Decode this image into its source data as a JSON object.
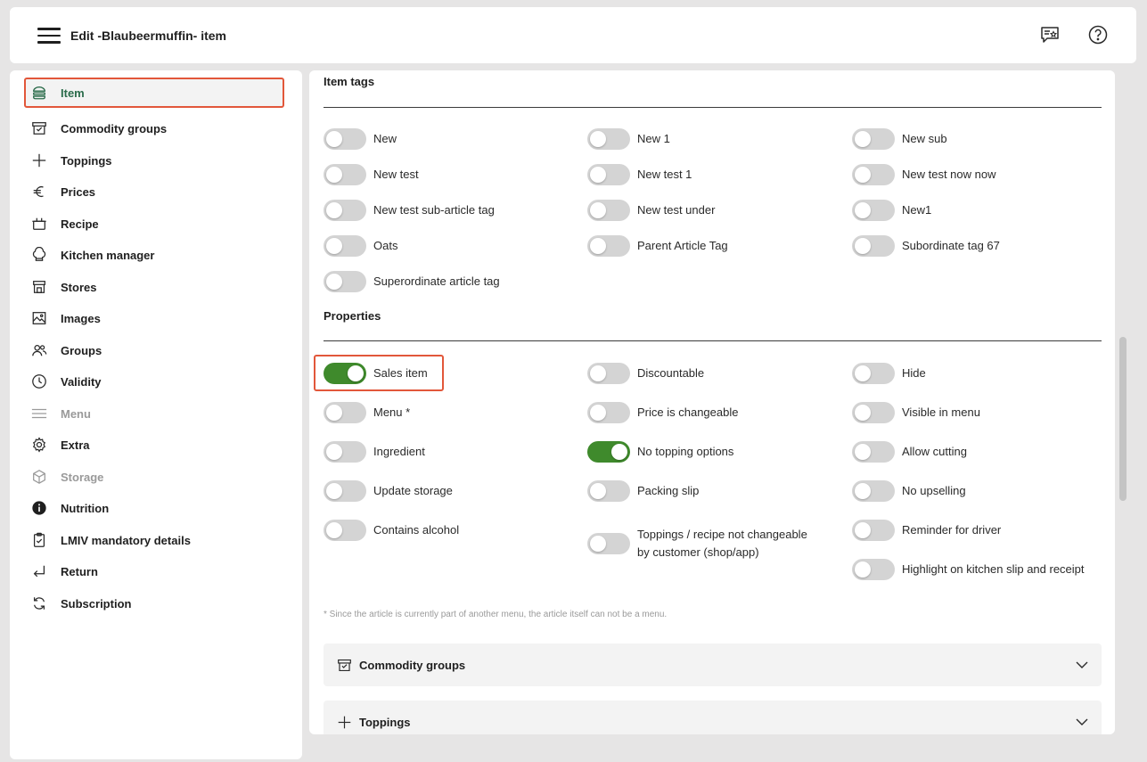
{
  "header": {
    "title": "Edit -Blaubeermuffin- item"
  },
  "sidebar": {
    "items": [
      {
        "label": "Item",
        "icon": "burger-icon"
      },
      {
        "label": "Commodity groups",
        "icon": "tag-box-icon"
      },
      {
        "label": "Toppings",
        "icon": "plus-icon"
      },
      {
        "label": "Prices",
        "icon": "euro-icon"
      },
      {
        "label": "Recipe",
        "icon": "pot-icon"
      },
      {
        "label": "Kitchen manager",
        "icon": "chef-hat-icon"
      },
      {
        "label": "Stores",
        "icon": "store-icon"
      },
      {
        "label": "Images",
        "icon": "image-icon"
      },
      {
        "label": "Groups",
        "icon": "users-icon"
      },
      {
        "label": "Validity",
        "icon": "clock-icon"
      },
      {
        "label": "Menu",
        "icon": "menu-lines-icon"
      },
      {
        "label": "Extra",
        "icon": "gear-icon"
      },
      {
        "label": "Storage",
        "icon": "cube-icon"
      },
      {
        "label": "Nutrition",
        "icon": "info-icon"
      },
      {
        "label": "LMIV mandatory details",
        "icon": "clipboard-check-icon"
      },
      {
        "label": "Return",
        "icon": "return-icon"
      },
      {
        "label": "Subscription",
        "icon": "refresh-icon"
      }
    ]
  },
  "item_tags": {
    "title": "Item tags",
    "toggles": [
      {
        "label": "New",
        "on": false
      },
      {
        "label": "New 1",
        "on": false
      },
      {
        "label": "New sub",
        "on": false
      },
      {
        "label": "New test",
        "on": false
      },
      {
        "label": "New test 1",
        "on": false
      },
      {
        "label": "New test now now",
        "on": false
      },
      {
        "label": "New test sub-article tag",
        "on": false
      },
      {
        "label": "New test under",
        "on": false
      },
      {
        "label": "New1",
        "on": false
      },
      {
        "label": "Oats",
        "on": false
      },
      {
        "label": "Parent Article Tag",
        "on": false
      },
      {
        "label": "Subordinate tag 67",
        "on": false
      },
      {
        "label": "Superordinate article tag",
        "on": false
      }
    ]
  },
  "properties": {
    "title": "Properties",
    "toggles": [
      {
        "label": "Sales item",
        "on": true
      },
      {
        "label": "Discountable",
        "on": false
      },
      {
        "label": "Hide",
        "on": false
      },
      {
        "label": "Menu *",
        "on": false
      },
      {
        "label": "Price is changeable",
        "on": false
      },
      {
        "label": "Visible in menu",
        "on": false
      },
      {
        "label": "Ingredient",
        "on": false
      },
      {
        "label": "No topping options",
        "on": true
      },
      {
        "label": "Allow cutting",
        "on": false
      },
      {
        "label": "Update storage",
        "on": false
      },
      {
        "label": "Packing slip",
        "on": false
      },
      {
        "label": "No upselling",
        "on": false
      },
      {
        "label": "Contains alcohol",
        "on": false
      },
      {
        "label": "Toppings / recipe not changeable",
        "label2": "by customer (shop/app)",
        "on": false
      },
      {
        "label": "Reminder for driver",
        "on": false
      },
      {
        "label": "Highlight on kitchen slip and receipt",
        "on": false
      }
    ],
    "footnote": "* Since the article is currently part of another menu, the article itself can not be a menu."
  },
  "accordions": [
    {
      "label": "Commodity groups",
      "icon": "tag-box-icon"
    },
    {
      "label": "Toppings",
      "icon": "plus-icon"
    }
  ],
  "colors": {
    "accent_green": "#3f8a2c",
    "active_text": "#2a6b4a",
    "highlight": "#e2573a"
  }
}
